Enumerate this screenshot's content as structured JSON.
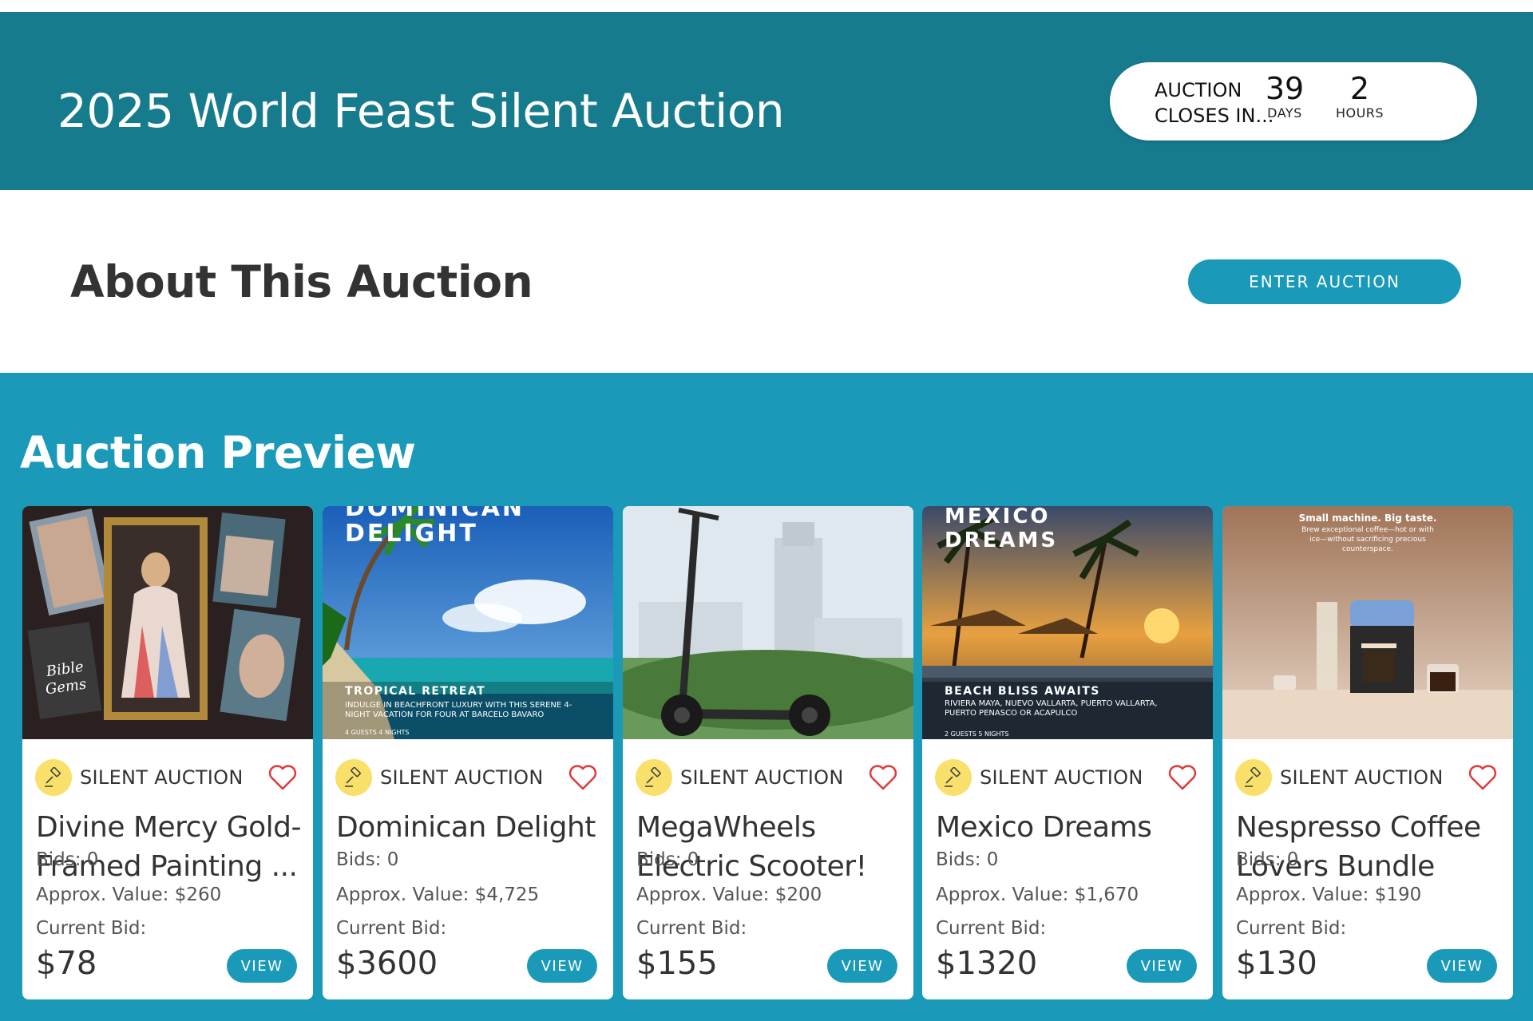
{
  "header": {
    "title": "2025 World Feast Silent Auction",
    "countdown": {
      "label_line1": "AUCTION",
      "label_line2": "CLOSES IN...",
      "days_value": "39",
      "days_label": "DAYS",
      "hours_value": "2",
      "hours_label": "HOURS"
    }
  },
  "about": {
    "title": "About This Auction",
    "enter_button": "ENTER AUCTION"
  },
  "preview": {
    "title": "Auction Preview",
    "cards": [
      {
        "type_label": "SILENT AUCTION",
        "title": "Divine Mercy Gold-Framed Painting ...",
        "bids": "Bids: 0",
        "approx_value": "Approx. Value: $260",
        "current_bid_label": "Current Bid:",
        "price": "$78",
        "view_label": "VIEW",
        "image_text": {}
      },
      {
        "type_label": "SILENT AUCTION",
        "title": "Dominican Delight",
        "bids": "Bids: 0",
        "approx_value": "Approx. Value: $4,725",
        "current_bid_label": "Current Bid:",
        "price": "$3600",
        "view_label": "VIEW",
        "image_text": {
          "headline_1": "DOMINICAN",
          "headline_2": "DELIGHT",
          "sub": "TROPICAL RETREAT",
          "small": "INDULGE IN BEACHFRONT LUXURY WITH THIS SERENE 4-NIGHT VACATION FOR FOUR AT BARCELO BAVARO",
          "stats": "4 GUESTS   4 NIGHTS"
        }
      },
      {
        "type_label": "SILENT AUCTION",
        "title": "MegaWheels Electric Scooter!",
        "bids": "Bids: 0",
        "approx_value": "Approx. Value: $200",
        "current_bid_label": "Current Bid:",
        "price": "$155",
        "view_label": "VIEW",
        "image_text": {}
      },
      {
        "type_label": "SILENT AUCTION",
        "title": "Mexico Dreams",
        "bids": "Bids: 0",
        "approx_value": "Approx. Value: $1,670",
        "current_bid_label": "Current Bid:",
        "price": "$1320",
        "view_label": "VIEW",
        "image_text": {
          "headline_1": "MEXICO",
          "headline_2": "DREAMS",
          "sub": "BEACH BLISS AWAITS",
          "small": "RIVIERA MAYA, NUEVO VALLARTA, PUERTO VALLARTA, PUERTO PENASCO OR ACAPULCO",
          "stats": "2 GUESTS   5 NIGHTS"
        }
      },
      {
        "type_label": "SILENT AUCTION",
        "title": "Nespresso Coffee Lovers Bundle",
        "bids": "Bids: 0",
        "approx_value": "Approx. Value: $190",
        "current_bid_label": "Current Bid:",
        "price": "$130",
        "view_label": "VIEW",
        "image_text": {
          "headline_1": "Small machine. Big taste.",
          "small": "Brew exceptional coffee—hot or with ice—without sacrificing precious counterspace."
        }
      }
    ]
  },
  "colors": {
    "header_bg": "#177b8e",
    "accent": "#1a9ab8",
    "gavel_bg": "#f9e06a",
    "heart": "#e03a3a"
  }
}
